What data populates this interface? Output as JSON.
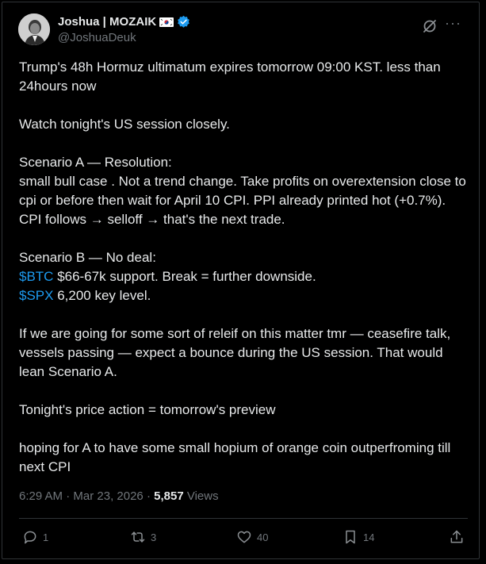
{
  "author": {
    "name": "Joshua | MOZAIK",
    "handle": "@JoshuaDeuk",
    "flag_icon": "south-korea-flag-icon",
    "verified_icon": "verified-badge-icon",
    "verified_color": "#1d9bf0"
  },
  "tweet": {
    "p1": "Trump's 48h Hormuz ultimatum expires tomorrow 09:00 KST.  less than 24hours now",
    "p2": "Watch tonight's US session closely.",
    "p3_line1": "Scenario A — Resolution:",
    "p3_line2": "small bull case . Not a trend change. Take profits on overextension close to cpi or before  then wait for April 10 CPI. PPI already printed hot (+0.7%). CPI follows → selloff → that's the next trade.",
    "p4_line1": "Scenario B — No deal:",
    "p4_cashtag1": "$BTC",
    "p4_line2": " $66-67k support. Break = further downside.",
    "p4_cashtag2": "$SPX",
    "p4_line3": " 6,200 key level.",
    "p5": "If  we are going for some sort of releif on this matter tmr  — ceasefire talk, vessels passing — expect a bounce during the US session. That would lean Scenario A.",
    "p6": "Tonight's price action = tomorrow's preview",
    "p7": "hoping for A  to have some small hopium of orange coin outperfroming till next CPI"
  },
  "meta": {
    "time": "6:29 AM",
    "separator": " · ",
    "date": "Mar 23, 2026",
    "views_count": "5,857",
    "views_label": " Views"
  },
  "actions": {
    "replies": "1",
    "reposts": "3",
    "likes": "40",
    "bookmarks": "14"
  },
  "colors": {
    "background": "#000000",
    "text": "#e7e9ea",
    "secondary": "#71767b",
    "link": "#1d9bf0",
    "border": "#2f3336"
  }
}
